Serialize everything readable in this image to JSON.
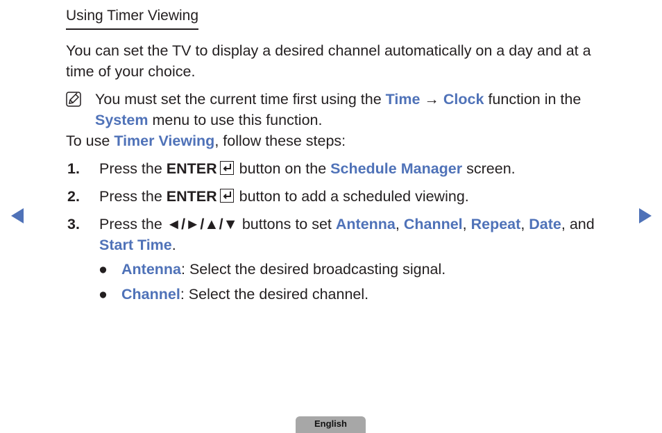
{
  "title": "Using Timer Viewing",
  "intro": "You can set the TV to display a desired channel automatically on a day and at a time of your choice.",
  "note": {
    "icon": "note-icon",
    "t1": "You must set the current time first using the ",
    "k1": "Time",
    "arrow": " → ",
    "k2": "Clock",
    "t2": " function in the ",
    "k3": "System",
    "t3": " menu to use this function."
  },
  "lead": {
    "t1": "To use ",
    "k1": "Timer Viewing",
    "t2": ", follow these steps:"
  },
  "steps": [
    {
      "num": "1.",
      "t1": "Press the ",
      "b1": "ENTER",
      "t2": " button on the ",
      "k1": "Schedule Manager",
      "t3": " screen."
    },
    {
      "num": "2.",
      "t1": "Press the ",
      "b1": "ENTER",
      "t2": " button to add a scheduled viewing."
    },
    {
      "num": "3.",
      "t1": "Press the ",
      "b1": "◄/►/▲/▼",
      "t2": " buttons to set ",
      "k1": "Antenna",
      "c1": ", ",
      "k2": "Channel",
      "c2": ", ",
      "k3": "Repeat",
      "c3": ", ",
      "k4": "Date",
      "c4": ", and ",
      "k5": "Start Time",
      "t3": "."
    }
  ],
  "bullets": [
    {
      "dot": "●",
      "k": "Antenna",
      "t": ": Select the desired broadcasting signal."
    },
    {
      "dot": "●",
      "k": "Channel",
      "t": ": Select the desired channel."
    }
  ],
  "footer": {
    "language": "English"
  },
  "colors": {
    "accent": "#4f72b8",
    "text": "#231f20",
    "tab": "#a7a7a7"
  }
}
